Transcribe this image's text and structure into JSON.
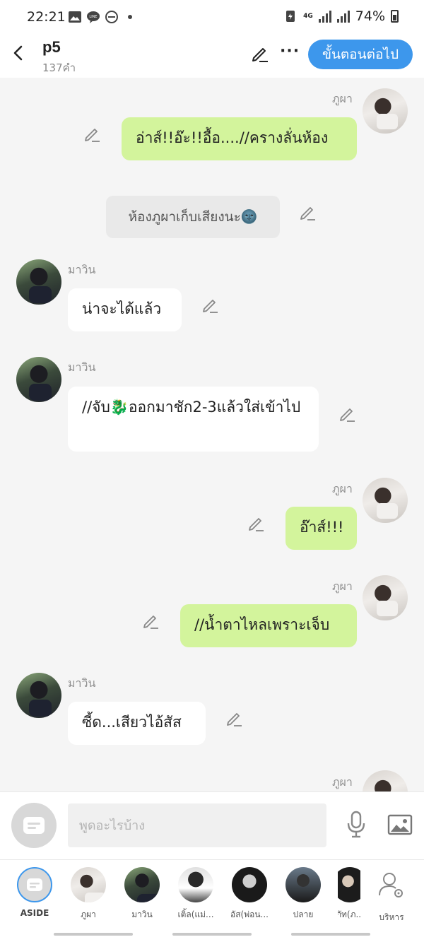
{
  "status": {
    "time": "22:21",
    "network": "4G",
    "battery": "74%"
  },
  "header": {
    "title": "p5",
    "word_count": "137คำ",
    "more": "···",
    "next_label": "ขั้นตอนต่อไป"
  },
  "messages": [
    {
      "sender": "ภูผา",
      "text": "อ่าส์!!อ๊ะ!!อื้อ....//ครางลั่นห้อง"
    },
    {
      "sender": "",
      "text": "ห้องภูผาเก็บเสียงนะ🌚"
    },
    {
      "sender": "มาวิน",
      "text": "น่าจะได้แล้ว"
    },
    {
      "sender": "มาวิน",
      "text": "//จับ🐉ออกมาชัก2-3แล้วใส่เข้าไป"
    },
    {
      "sender": "ภูผา",
      "text": "อ๊าส์!!!"
    },
    {
      "sender": "ภูผา",
      "text": "//น้ำตาไหลเพราะเจ็บ"
    },
    {
      "sender": "มาวิน",
      "text": "ซี้ด...เสียวไอ้สัส"
    },
    {
      "sender": "ภูผา",
      "text": ""
    }
  ],
  "composer": {
    "placeholder": "พูดอะไรบ้าง"
  },
  "characters": [
    {
      "label": "ASIDE"
    },
    {
      "label": "ภูผา"
    },
    {
      "label": "มาวิน"
    },
    {
      "label": "เติ้ล(แม่..."
    },
    {
      "label": "อัส(พ่อน..."
    },
    {
      "label": "ปลาย"
    },
    {
      "label": "ภัท(ภ..."
    },
    {
      "label": "บริหาร"
    }
  ]
}
